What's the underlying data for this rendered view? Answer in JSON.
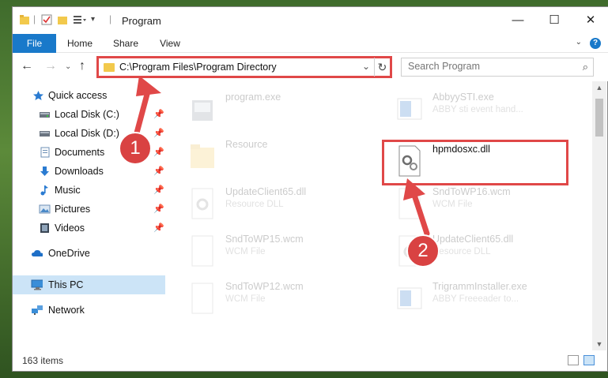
{
  "window": {
    "title": "Program"
  },
  "ribbon": {
    "tabs": [
      "File",
      "Home",
      "Share",
      "View"
    ]
  },
  "navbar": {
    "address": "C:\\Program Files\\Program Directory",
    "search_placeholder": "Search Program"
  },
  "sidebar": {
    "items": [
      {
        "label": "Quick access",
        "icon": "star-icon"
      },
      {
        "label": "Local Disk (C:)",
        "icon": "drive-icon",
        "pinned": true
      },
      {
        "label": "Local Disk (D:)",
        "icon": "drive-icon",
        "pinned": true
      },
      {
        "label": "Documents",
        "icon": "documents-icon",
        "pinned": true
      },
      {
        "label": "Downloads",
        "icon": "download-icon",
        "pinned": true
      },
      {
        "label": "Music",
        "icon": "music-icon",
        "pinned": true
      },
      {
        "label": "Pictures",
        "icon": "pictures-icon",
        "pinned": true
      },
      {
        "label": "Videos",
        "icon": "videos-icon",
        "pinned": true
      },
      {
        "label": "OneDrive",
        "icon": "cloud-icon"
      },
      {
        "label": "This PC",
        "icon": "computer-icon",
        "selected": true
      },
      {
        "label": "Network",
        "icon": "network-icon"
      }
    ]
  },
  "files": {
    "left": [
      {
        "name": "program.exe",
        "sub": "",
        "icon": "exe-icon"
      },
      {
        "name": "Resource",
        "sub": "",
        "icon": "folder-icon"
      },
      {
        "name": "UpdateClient65.dll",
        "sub": "Resource DLL",
        "icon": "dll-icon"
      },
      {
        "name": "SndToWP15.wcm",
        "sub": "WCM File",
        "icon": "file-icon"
      },
      {
        "name": "SndToWP12.wcm",
        "sub": "WCM File",
        "icon": "file-icon"
      }
    ],
    "right": [
      {
        "name": "AbbyySTI.exe",
        "sub": "ABBY sti event hand...",
        "icon": "exe-icon"
      },
      {
        "name": "hpmdosxc.dll",
        "sub": "",
        "icon": "dll-gear-icon",
        "highlighted": true
      },
      {
        "name": "SndToWP16.wcm",
        "sub": "WCM File",
        "icon": "file-icon"
      },
      {
        "name": "UpdateClient65.dll",
        "sub": "Resource DLL",
        "icon": "dll-icon"
      },
      {
        "name": "TrigrammInstaller.exe",
        "sub": "ABBY Freeeader to...",
        "icon": "exe-icon"
      }
    ]
  },
  "status": {
    "item_count": "163 items"
  },
  "callouts": [
    "1",
    "2"
  ],
  "colors": {
    "accent": "#1979ca",
    "highlight": "#e04848",
    "selected": "#cce4f7"
  }
}
